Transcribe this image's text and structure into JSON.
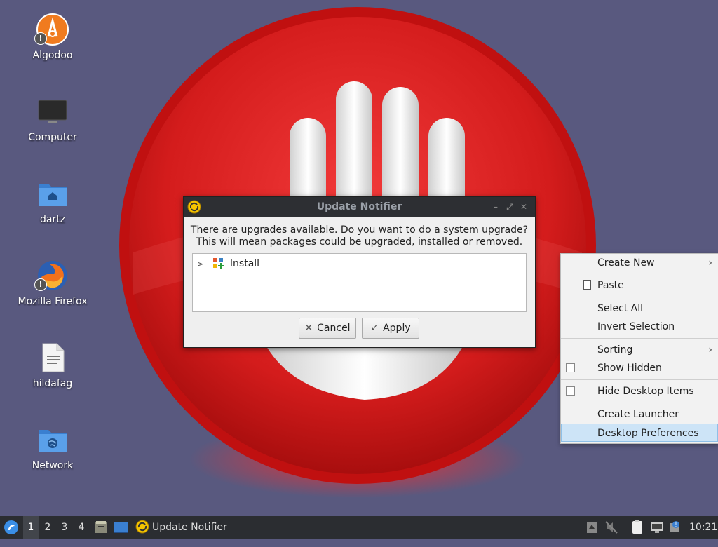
{
  "desktop": {
    "icons": [
      {
        "label": "Algodoo",
        "icon": "algodoo-icon",
        "badge": "!"
      },
      {
        "label": "Computer",
        "icon": "monitor-icon"
      },
      {
        "label": "dartz",
        "icon": "home-folder-icon"
      },
      {
        "label": "Mozilla Firefox",
        "icon": "firefox-icon",
        "badge": "!"
      },
      {
        "label": "hildafag",
        "icon": "text-file-icon"
      },
      {
        "label": "Network",
        "icon": "network-folder-icon"
      }
    ]
  },
  "dialog": {
    "title": "Update Notifier",
    "message_line1": "There are upgrades available. Do you want to do a system upgrade?",
    "message_line2": "This will mean packages could be upgraded, installed or removed.",
    "tree_item": "Install",
    "cancel_label": "Cancel",
    "apply_label": "Apply",
    "window_buttons": {
      "minimize": "–",
      "maximize": "⤢",
      "close": "✕"
    }
  },
  "context_menu": {
    "create_new": "Create New",
    "paste": "Paste",
    "select_all": "Select All",
    "invert_selection": "Invert Selection",
    "sorting": "Sorting",
    "show_hidden": "Show Hidden",
    "hide_desktop_items": "Hide Desktop Items",
    "create_launcher": "Create Launcher",
    "desktop_preferences": "Desktop Preferences",
    "submenu_arrow": "›"
  },
  "taskbar": {
    "workspaces": [
      "1",
      "2",
      "3",
      "4"
    ],
    "active_workspace": "1",
    "task_label": "Update Notifier",
    "clock": "10:21"
  },
  "colors": {
    "background": "#59597f",
    "wallpaper_red": "#d81f1f",
    "menu_highlight": "#cde4f7",
    "titlebar": "#2d2f33",
    "taskbar": "#2b2d31"
  }
}
